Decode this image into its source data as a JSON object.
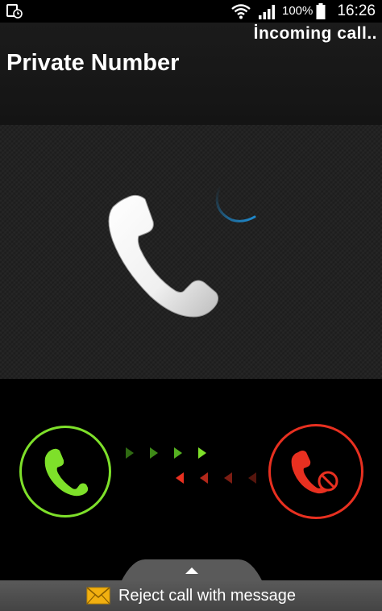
{
  "status_bar": {
    "battery_percent": "100%",
    "time": "16:26",
    "icons": [
      "notification-icon",
      "wifi-icon",
      "signal-icon",
      "battery-icon"
    ]
  },
  "call": {
    "status": "İncoming call..",
    "caller": "Private Number"
  },
  "controls": {
    "answer_icon": "phone-icon",
    "reject_icon": "phone-hangup-icon"
  },
  "reject_message": {
    "label": "Reject call with message",
    "icon": "envelope-icon"
  },
  "colors": {
    "answer": "#7ee02a",
    "reject": "#e83020",
    "spinner": "#1e8fd6"
  }
}
